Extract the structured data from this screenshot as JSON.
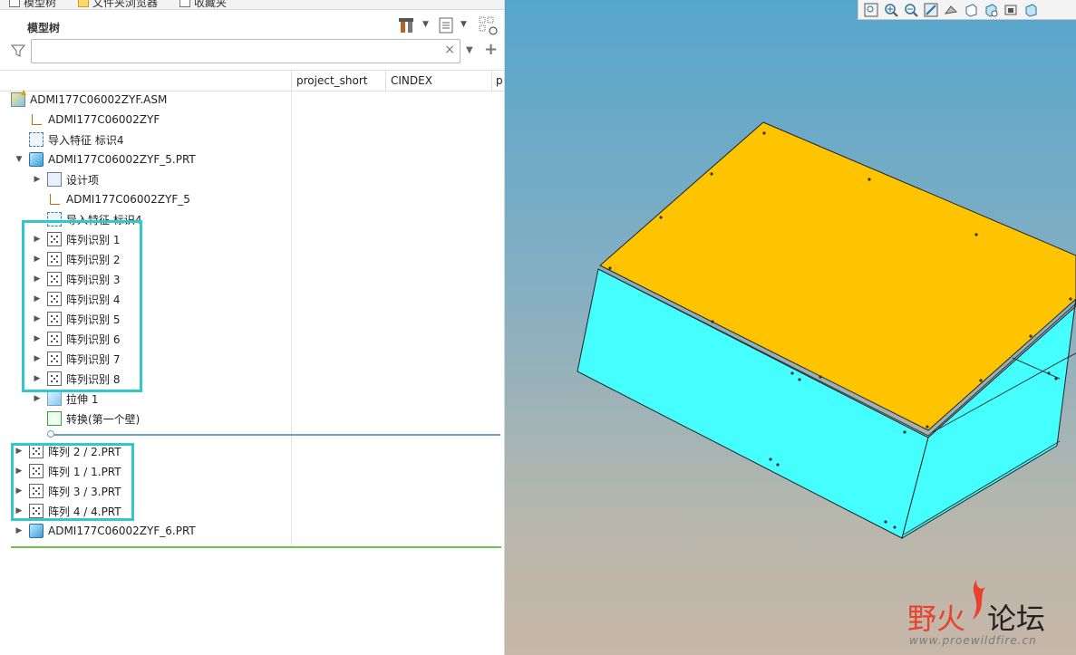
{
  "tabs": [
    "模型树",
    "文件夹浏览器",
    "收藏夹"
  ],
  "panel": {
    "title": "模型树",
    "search_placeholder": "",
    "clear": "×",
    "add": "+"
  },
  "columns": [
    "project_short",
    "CINDEX",
    "p"
  ],
  "tree": {
    "root": "ADMI177C06002ZYF.ASM",
    "csys": "ADMI177C06002ZYF",
    "import1": "导入特征 标识4",
    "part5": "ADMI177C06002ZYF_5.PRT",
    "design": "设计项",
    "csys5": "ADMI177C06002ZYF_5",
    "import2": "导入特征 标识4",
    "patterns": [
      "阵列识别 1",
      "阵列识别 2",
      "阵列识别 3",
      "阵列识别 4",
      "阵列识别 5",
      "阵列识别 6",
      "阵列识别 7",
      "阵列识别 8"
    ],
    "extrude": "拉伸 1",
    "convert": "转换(第一个壁)",
    "asm_patterns": [
      "阵列 2 / 2.PRT",
      "阵列 1 / 1.PRT",
      "阵列 3 / 3.PRT",
      "阵列 4 / 4.PRT"
    ],
    "part6": "ADMI177C06002ZYF_6.PRT"
  },
  "watermark": {
    "red": "野火",
    "dark": "论坛",
    "url": "www.proewildfire.cn"
  },
  "colors": {
    "highlight": "#31c8cc",
    "box_top": "#ffc400",
    "box_side": "#45ffff",
    "insert_line": "#6aa3c8",
    "end_line": "#6cc24a"
  },
  "icons": [
    "filter-icon",
    "tools-icon",
    "settings-icon",
    "show-icon",
    "zoom-fit-icon",
    "zoom-in-icon",
    "zoom-out-icon",
    "repaint-icon",
    "display-style-icon",
    "saved-orientations-icon",
    "view-manager-icon",
    "perspective-icon",
    "datum-display-icon"
  ]
}
